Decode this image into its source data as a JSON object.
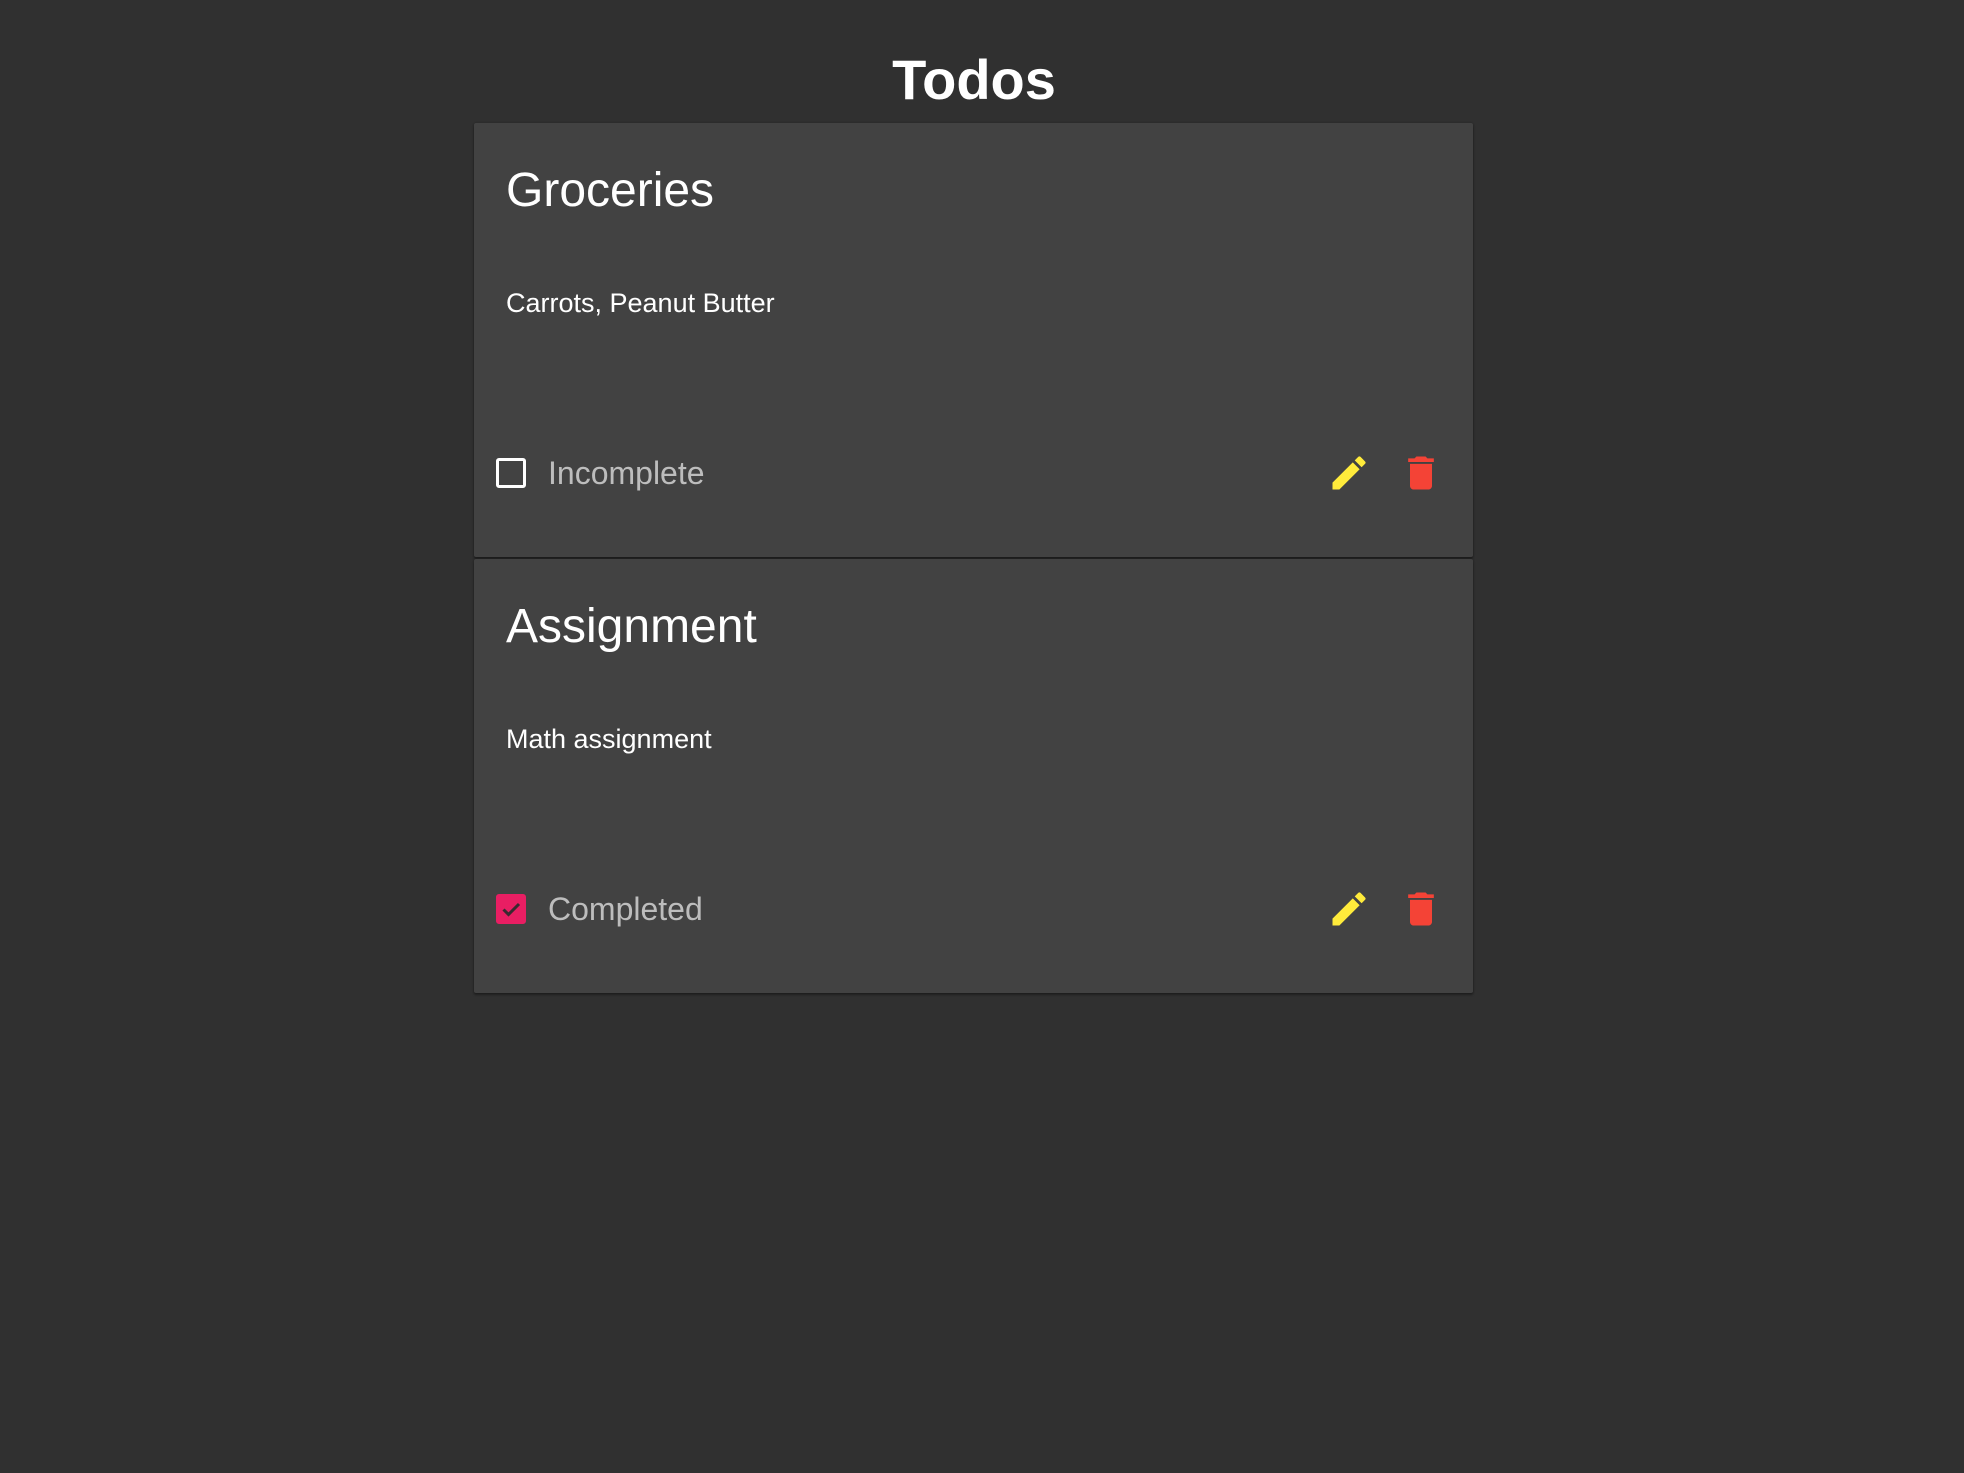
{
  "header": {
    "title": "Todos"
  },
  "todos": [
    {
      "title": "Groceries",
      "description": "Carrots, Peanut Butter",
      "completed": false,
      "status_label": "Incomplete"
    },
    {
      "title": "Assignment",
      "description": "Math assignment",
      "completed": true,
      "status_label": "Completed"
    }
  ],
  "icons": {
    "checkbox_unchecked": "checkbox-blank-icon",
    "checkbox_checked": "checkbox-checked-icon",
    "edit": "pencil-icon",
    "delete": "trash-icon"
  },
  "colors": {
    "background": "#303030",
    "card": "#424242",
    "checkbox_accent": "#e91e63",
    "edit_icon": "#ffeb3b",
    "delete_icon": "#f44336",
    "status_text": "#bdbdbd"
  }
}
